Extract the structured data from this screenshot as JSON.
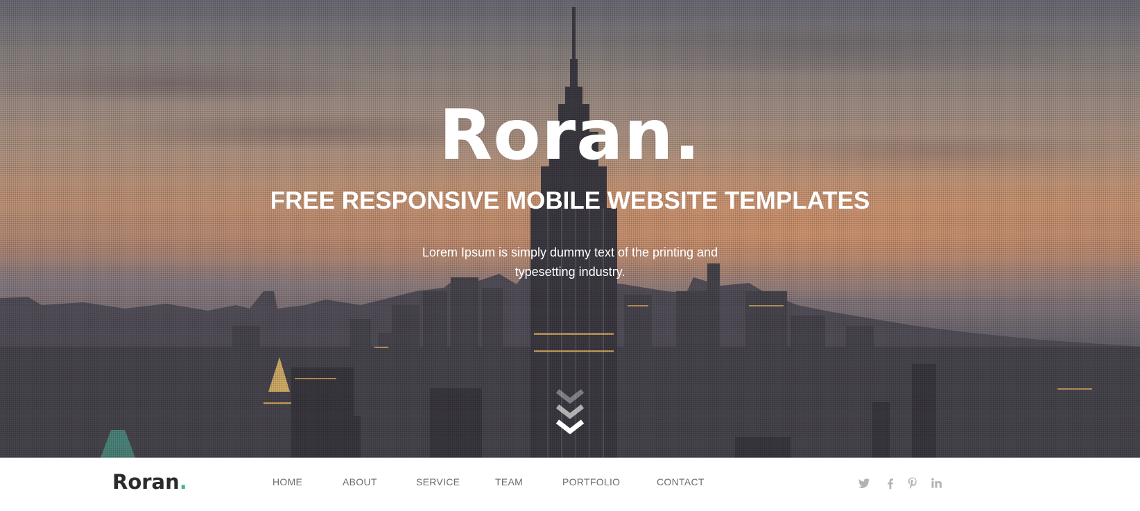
{
  "hero": {
    "title": "Roran",
    "title_dot": ".",
    "subtitle": "FREE RESPONSIVE MOBILE WEBSITE TEMPLATES",
    "text": "Lorem Ipsum is simply dummy text of the printing and typesetting industry.",
    "scroll_icon": "triple-chevron-down-icon"
  },
  "navbar": {
    "logo_text": "Roran",
    "logo_dot": ".",
    "menu": [
      {
        "label": "HOME"
      },
      {
        "label": "ABOUT"
      },
      {
        "label": "SERVICE"
      },
      {
        "label": "TEAM"
      },
      {
        "label": "PORTFOLIO"
      },
      {
        "label": "CONTACT"
      }
    ],
    "social": [
      "twitter-icon",
      "facebook-icon",
      "pinterest-icon",
      "linkedin-icon"
    ]
  },
  "colors": {
    "accent": "#3fb399",
    "nav_text": "#6b6b6b",
    "logo_text": "#2b2b2b",
    "social_icon": "#b3b3b3"
  }
}
